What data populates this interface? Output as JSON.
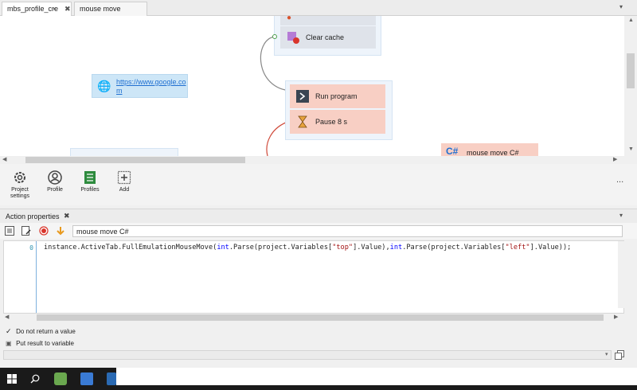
{
  "tabs": [
    {
      "label": "mbs_profile_cre",
      "active": true
    },
    {
      "label": "mouse move",
      "active": false
    }
  ],
  "canvas": {
    "url_node": {
      "text_line1": "https://www.google.co",
      "text_line2": "m"
    },
    "actions": [
      {
        "label": "Clear cache"
      },
      {
        "label": "Run program"
      },
      {
        "label": "Pause 8 s"
      }
    ],
    "partial_node": {
      "text": "mouse move C#"
    }
  },
  "toolbar": {
    "items": [
      {
        "label_line1": "Project",
        "label_line2": "settings"
      },
      {
        "label_line1": "Profile",
        "label_line2": ""
      },
      {
        "label_line1": "Profiles",
        "label_line2": ""
      },
      {
        "label_line1": "Add",
        "label_line2": ""
      }
    ],
    "more": "..."
  },
  "panel": {
    "title": "Action properties",
    "action_name": "mouse move C#"
  },
  "editor": {
    "line_number": "0",
    "code_prefix": "instance.ActiveTab.FullEmulationMouseMove(",
    "kw1": "int",
    "mid1": ".Parse(project.Variables[",
    "str1": "\"top\"",
    "mid2": "].Value),",
    "kw2": "int",
    "mid3": ".Parse(project.Variables[",
    "str2": "\"left\"",
    "code_suffix": "].Value));"
  },
  "options": {
    "do_not_return": "Do not return a value",
    "put_result": "Put result to variable"
  },
  "colors": {
    "keyword": "#0000ff",
    "string": "#a31515",
    "accent": "#1f6fd1"
  }
}
